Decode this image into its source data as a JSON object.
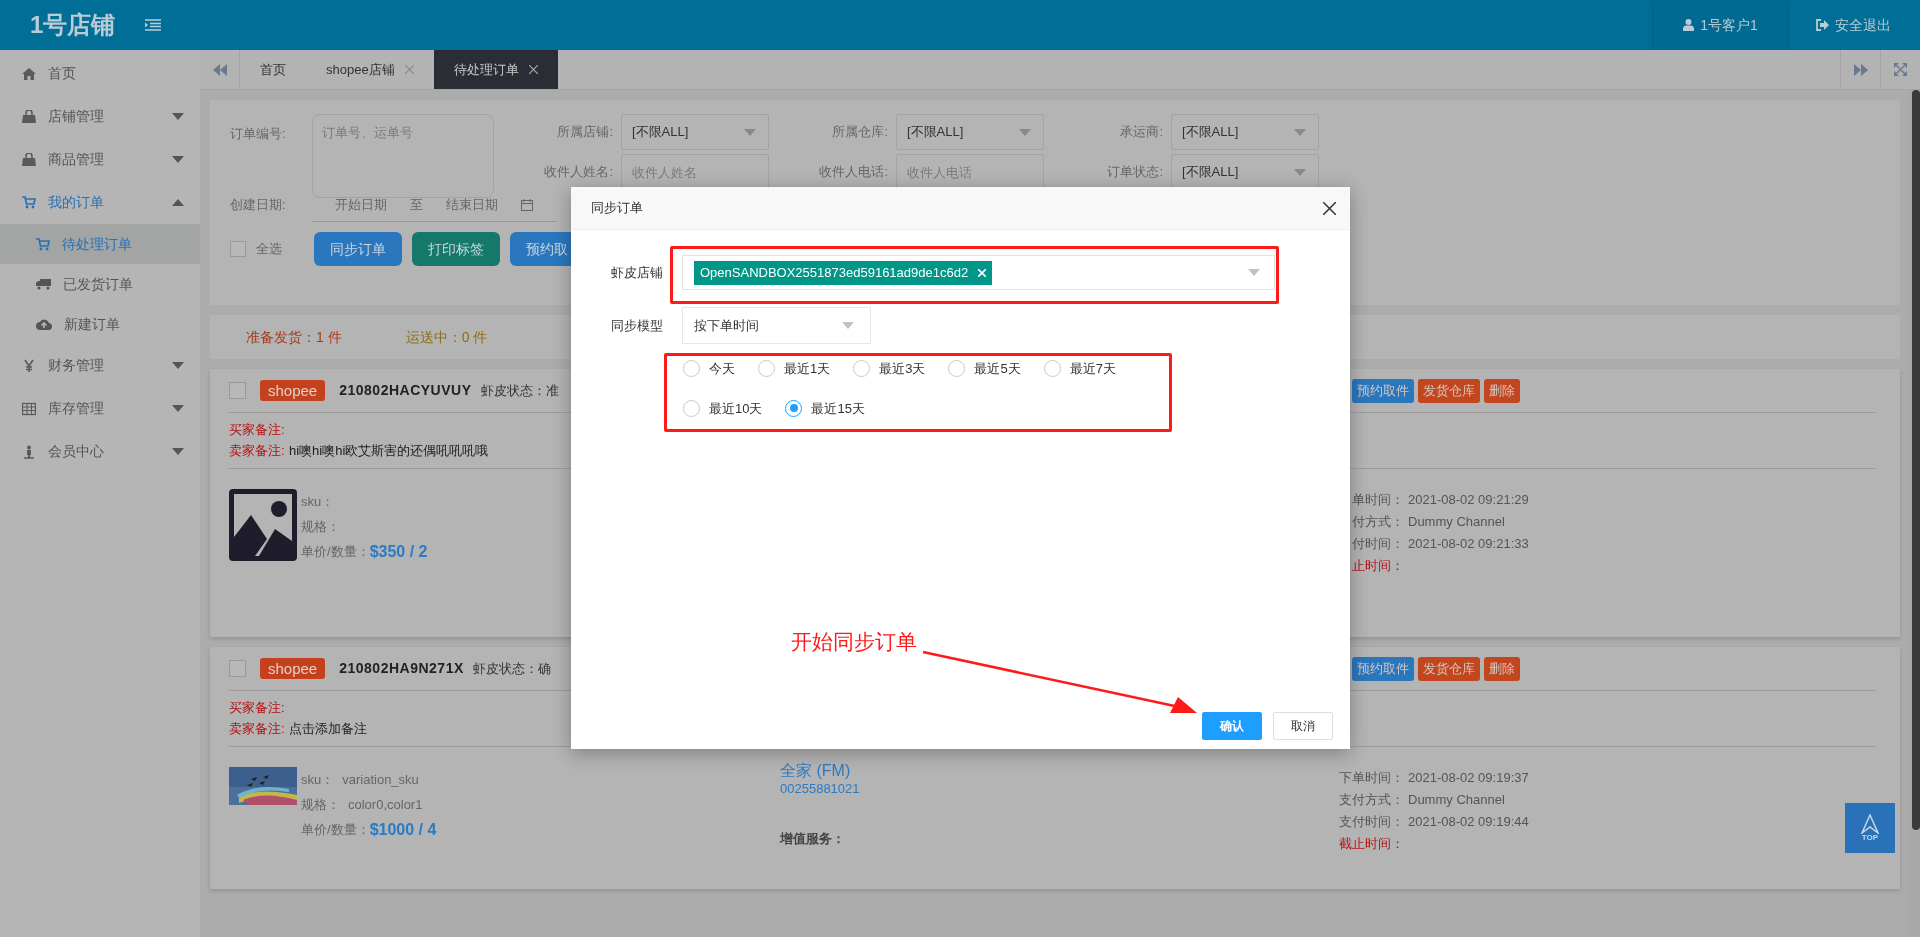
{
  "header": {
    "logo": "1号店铺",
    "user": "1号客户1",
    "logout": "安全退出"
  },
  "sidebar": {
    "items": [
      {
        "label": "首页",
        "kind": "link",
        "selected": false
      },
      {
        "label": "店铺管理",
        "kind": "menu",
        "expanded": false,
        "selected": false
      },
      {
        "label": "商品管理",
        "kind": "menu",
        "expanded": false,
        "selected": false
      },
      {
        "label": "我的订单",
        "kind": "menu",
        "expanded": true,
        "selected": true,
        "children": [
          {
            "label": "待处理订单",
            "selected": true
          },
          {
            "label": "已发货订单",
            "selected": false
          },
          {
            "label": "新建订单",
            "selected": false
          }
        ]
      },
      {
        "label": "财务管理",
        "kind": "menu",
        "expanded": false,
        "selected": false
      },
      {
        "label": "库存管理",
        "kind": "menu",
        "expanded": false,
        "selected": false
      },
      {
        "label": "会员中心",
        "kind": "menu",
        "expanded": false,
        "selected": false
      }
    ]
  },
  "tabs": [
    {
      "label": "首页",
      "closable": false,
      "selected": false
    },
    {
      "label": "shopee店铺",
      "closable": true,
      "selected": false
    },
    {
      "label": "待处理订单",
      "closable": true,
      "selected": true
    }
  ],
  "filters": {
    "order_no": {
      "label": "订单编号:",
      "placeholder": "订单号、运单号"
    },
    "row1": [
      {
        "label": "所属店铺:",
        "kind": "select",
        "value": "[不限ALL]"
      },
      {
        "label": "所属仓库:",
        "kind": "select",
        "value": "[不限ALL]"
      },
      {
        "label": "承运商:",
        "kind": "select",
        "value": "[不限ALL]"
      }
    ],
    "row2": [
      {
        "label": "收件人姓名:",
        "kind": "input",
        "placeholder": "收件人姓名"
      },
      {
        "label": "收件人电话:",
        "kind": "input",
        "placeholder": "收件人电话"
      },
      {
        "label": "订单状态:",
        "kind": "select",
        "value": "[不限ALL]"
      }
    ],
    "date": {
      "label": "创建日期:",
      "start_placeholder": "开始日期",
      "separator": "至",
      "end_placeholder": "结束日期"
    },
    "select_all": {
      "label": "全选",
      "checked": false
    },
    "buttons": [
      {
        "label": "同步订单",
        "color": "#2a77bd"
      },
      {
        "label": "打印标签",
        "color": "#14796a"
      },
      {
        "label": "预约取",
        "color": "#2a77bd"
      }
    ]
  },
  "stats": [
    {
      "text": "准备发货：1 件",
      "color": "#a83a1c"
    },
    {
      "text": "运送中：0 件",
      "color": "#8d6d12"
    }
  ],
  "orders": [
    {
      "checked": false,
      "platform": "shopee",
      "order_no": "210802HACYUVUY",
      "status": "虾皮状态：准",
      "buyer_note_label": "买家备注:",
      "seller_note_label": "卖家备注:",
      "seller_note": "hi噢hi噢hi欧艾斯害的还偶吼吼吼哦",
      "image": {
        "kind": "placeholder"
      },
      "sku_label": "sku：",
      "spec_label": "规格：",
      "price_label": "单价/数量：",
      "price": "$350 / 2",
      "actions": [
        {
          "label": "预约取件",
          "color": "#2a77bd"
        },
        {
          "label": "发货仓库",
          "color": "#c2461e"
        },
        {
          "label": "删除",
          "color": "#c2461e"
        }
      ],
      "times": [
        {
          "label": "单时间：",
          "value": "2021-08-02 09:21:29"
        },
        {
          "label": "付方式：",
          "value": "Dummy Channel"
        },
        {
          "label": "付时间：",
          "value": "2021-08-02 09:21:33"
        }
      ],
      "deadline_label": "止时间："
    },
    {
      "checked": false,
      "platform": "shopee",
      "order_no": "210802HA9N271X",
      "status": "虾皮状态：确",
      "buyer_note_label": "买家备注:",
      "seller_note_label": "卖家备注:",
      "seller_note": "点击添加备注",
      "sku_label": "sku：",
      "sku": "variation_sku",
      "spec_label": "规格：",
      "spec": "color0,color1",
      "price_label": "单价/数量：",
      "price": "$1000 / 4",
      "carrier": "全家 (FM)",
      "tracking": "00255881021",
      "service_label": "增值服务：",
      "actions": [
        {
          "label": "预约取件",
          "color": "#2a77bd"
        },
        {
          "label": "发货仓库",
          "color": "#c2461e"
        },
        {
          "label": "删除",
          "color": "#c2461e"
        }
      ],
      "times": [
        {
          "label": "下单时间：",
          "value": "2021-08-02 09:19:37"
        },
        {
          "label": "支付方式：",
          "value": "Dummy Channel"
        },
        {
          "label": "支付时间：",
          "value": "2021-08-02 09:19:44"
        }
      ],
      "deadline_label": "截止时间："
    }
  ],
  "dialog": {
    "title": "同步订单",
    "store": {
      "label": "虾皮店铺",
      "tags": [
        "OpenSANDBOX2551873ed59161ad9de1c6d2"
      ]
    },
    "mode": {
      "label": "同步模型",
      "value": "按下单时间"
    },
    "ranges": [
      {
        "label": "今天",
        "selected": false
      },
      {
        "label": "最近1天",
        "selected": false
      },
      {
        "label": "最近3天",
        "selected": false
      },
      {
        "label": "最近5天",
        "selected": false
      },
      {
        "label": "最近7天",
        "selected": false
      },
      {
        "label": "最近10天",
        "selected": false
      },
      {
        "label": "最近15天",
        "selected": true
      }
    ],
    "buttons": [
      {
        "label": "确认",
        "kind": "primary"
      },
      {
        "label": "取消",
        "kind": "default"
      }
    ]
  },
  "annotation": {
    "text": "开始同步订单"
  },
  "top_button": {
    "label": "TOP"
  }
}
